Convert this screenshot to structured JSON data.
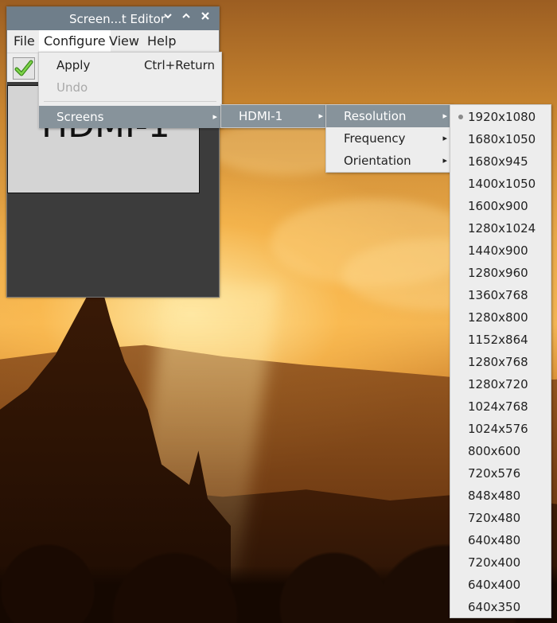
{
  "window": {
    "title": "Screen...t Editor",
    "menubar": [
      "File",
      "Configure",
      "View",
      "Help"
    ],
    "screen_label": "HDMI-1"
  },
  "configure_menu": {
    "items": [
      {
        "label": "Apply",
        "shortcut": "Ctrl+Return",
        "disabled": false
      },
      {
        "label": "Undo",
        "shortcut": "",
        "disabled": true
      },
      {
        "label": "Screens",
        "submenu": true,
        "highlighted": true
      }
    ]
  },
  "screens_menu": {
    "items": [
      {
        "label": "HDMI-1",
        "submenu": true,
        "highlighted": true
      }
    ]
  },
  "hdmi_menu": {
    "items": [
      {
        "label": "Resolution",
        "submenu": true,
        "highlighted": true
      },
      {
        "label": "Frequency",
        "submenu": true
      },
      {
        "label": "Orientation",
        "submenu": true
      }
    ]
  },
  "resolution_menu": {
    "selected": "1920x1080",
    "items": [
      "1920x1080",
      "1680x1050",
      "1680x945",
      "1400x1050",
      "1600x900",
      "1280x1024",
      "1440x900",
      "1280x960",
      "1360x768",
      "1280x800",
      "1152x864",
      "1280x768",
      "1280x720",
      "1024x768",
      "1024x576",
      "800x600",
      "720x576",
      "848x480",
      "720x480",
      "640x480",
      "720x400",
      "640x400",
      "640x350"
    ]
  },
  "colors": {
    "titlebar": "#6f7e8a",
    "menu_bg": "#ededed",
    "highlight": "#87939b"
  }
}
